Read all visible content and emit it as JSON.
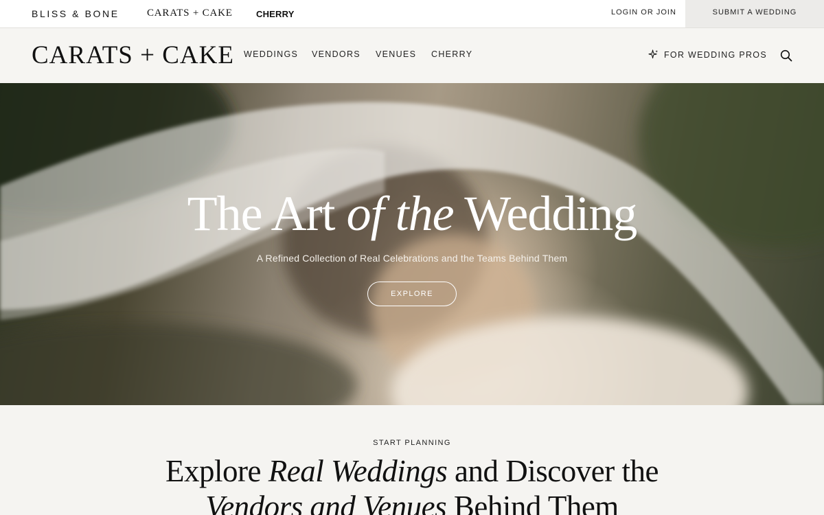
{
  "topbar": {
    "brands": [
      "BLISS & BONE",
      "CARATS + CAKE",
      "CHERRY"
    ],
    "login_label": "LOGIN OR JOIN",
    "submit_label": "SUBMIT A WEDDING"
  },
  "header": {
    "logo": "CARATS + CAKE",
    "nav": [
      "WEDDINGS",
      "VENDORS",
      "VENUES",
      "CHERRY"
    ],
    "pros_label": "FOR WEDDING PROS",
    "icons": [
      "sparkle-icon",
      "search-icon"
    ]
  },
  "hero": {
    "title_part1": "The Art ",
    "title_italic": "of the",
    "title_part2": " Wedding",
    "subtitle": "A Refined Collection of Real Celebrations and the Teams Behind Them",
    "button_label": "EXPLORE"
  },
  "planning": {
    "eyebrow": "START PLANNING",
    "line1_part1": "Explore ",
    "line1_italic": "Real Weddings",
    "line1_part2": " and Discover the",
    "line2_italic": "Vendors and Venues",
    "line2_part2": " Behind Them"
  },
  "colors": {
    "topbar_bg": "#ffffff",
    "header_bg": "#f6f5f2",
    "submit_bg": "#ecebe9",
    "text": "#111111"
  }
}
